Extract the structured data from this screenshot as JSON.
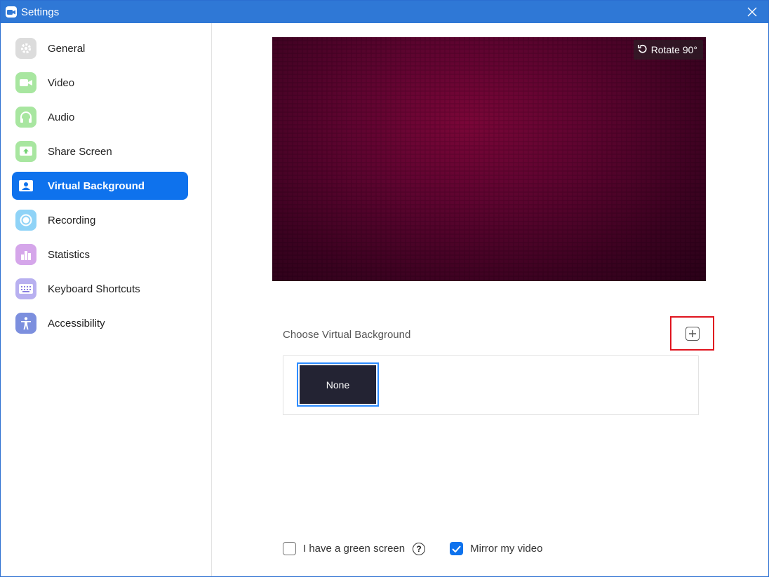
{
  "window": {
    "title": "Settings"
  },
  "sidebar": {
    "items": [
      {
        "label": "General",
        "icon": "gear-icon",
        "color": "#d9d9d9",
        "active": false
      },
      {
        "label": "Video",
        "icon": "video-camera-icon",
        "color": "#6fd16f",
        "active": false
      },
      {
        "label": "Audio",
        "icon": "headphones-icon",
        "color": "#6fd16f",
        "active": false
      },
      {
        "label": "Share Screen",
        "icon": "share-screen-icon",
        "color": "#6fd16f",
        "active": false
      },
      {
        "label": "Virtual Background",
        "icon": "person-card-icon",
        "color": "#0e72ed",
        "active": true
      },
      {
        "label": "Recording",
        "icon": "record-icon",
        "color": "#4fb6f0",
        "active": false
      },
      {
        "label": "Statistics",
        "icon": "bar-chart-icon",
        "color": "#b36ad6",
        "active": false
      },
      {
        "label": "Keyboard Shortcuts",
        "icon": "keyboard-icon",
        "color": "#8a7fe0",
        "active": false
      },
      {
        "label": "Accessibility",
        "icon": "accessibility-icon",
        "color": "#6a7fd6",
        "active": false
      }
    ]
  },
  "preview": {
    "rotate_label": "Rotate 90°"
  },
  "backgrounds": {
    "heading": "Choose Virtual Background",
    "add_icon": "plus-icon",
    "items": [
      {
        "label": "None",
        "selected": true
      }
    ]
  },
  "options": {
    "green_screen": {
      "label": "I have a green screen",
      "checked": false
    },
    "mirror": {
      "label": "Mirror my video",
      "checked": true
    }
  },
  "colors": {
    "accent": "#0e72ed",
    "titlebar": "#2f78d6",
    "highlight_border": "#e0141e"
  }
}
